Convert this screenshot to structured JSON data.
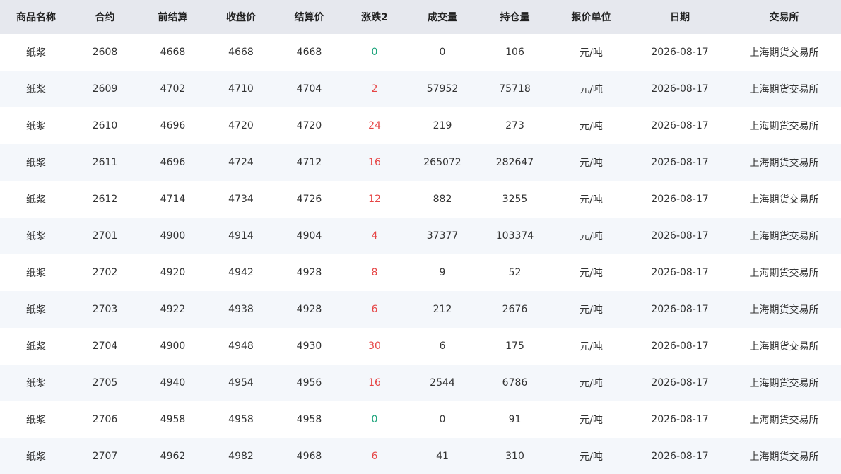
{
  "table": {
    "headers": [
      "商品名称",
      "合约",
      "前结算",
      "收盘价",
      "结算价",
      "涨跌2",
      "成交量",
      "持仓量",
      "报价单位",
      "日期",
      "交易所"
    ],
    "rows": [
      {
        "name": "纸浆",
        "contract": "2608",
        "prev_settle": "4668",
        "close": "4668",
        "settle": "4668",
        "change": "0",
        "volume": "0",
        "open_interest": "106",
        "unit": "元/吨",
        "date": "2026-08-17",
        "exchange": "上海期货交易所"
      },
      {
        "name": "纸浆",
        "contract": "2609",
        "prev_settle": "4702",
        "close": "4710",
        "settle": "4704",
        "change": "2",
        "volume": "57952",
        "open_interest": "75718",
        "unit": "元/吨",
        "date": "2026-08-17",
        "exchange": "上海期货交易所"
      },
      {
        "name": "纸浆",
        "contract": "2610",
        "prev_settle": "4696",
        "close": "4720",
        "settle": "4720",
        "change": "24",
        "volume": "219",
        "open_interest": "273",
        "unit": "元/吨",
        "date": "2026-08-17",
        "exchange": "上海期货交易所"
      },
      {
        "name": "纸浆",
        "contract": "2611",
        "prev_settle": "4696",
        "close": "4724",
        "settle": "4712",
        "change": "16",
        "volume": "265072",
        "open_interest": "282647",
        "unit": "元/吨",
        "date": "2026-08-17",
        "exchange": "上海期货交易所"
      },
      {
        "name": "纸浆",
        "contract": "2612",
        "prev_settle": "4714",
        "close": "4734",
        "settle": "4726",
        "change": "12",
        "volume": "882",
        "open_interest": "3255",
        "unit": "元/吨",
        "date": "2026-08-17",
        "exchange": "上海期货交易所"
      },
      {
        "name": "纸浆",
        "contract": "2701",
        "prev_settle": "4900",
        "close": "4914",
        "settle": "4904",
        "change": "4",
        "volume": "37377",
        "open_interest": "103374",
        "unit": "元/吨",
        "date": "2026-08-17",
        "exchange": "上海期货交易所"
      },
      {
        "name": "纸浆",
        "contract": "2702",
        "prev_settle": "4920",
        "close": "4942",
        "settle": "4928",
        "change": "8",
        "volume": "9",
        "open_interest": "52",
        "unit": "元/吨",
        "date": "2026-08-17",
        "exchange": "上海期货交易所"
      },
      {
        "name": "纸浆",
        "contract": "2703",
        "prev_settle": "4922",
        "close": "4938",
        "settle": "4928",
        "change": "6",
        "volume": "212",
        "open_interest": "2676",
        "unit": "元/吨",
        "date": "2026-08-17",
        "exchange": "上海期货交易所"
      },
      {
        "name": "纸浆",
        "contract": "2704",
        "prev_settle": "4900",
        "close": "4948",
        "settle": "4930",
        "change": "30",
        "volume": "6",
        "open_interest": "175",
        "unit": "元/吨",
        "date": "2026-08-17",
        "exchange": "上海期货交易所"
      },
      {
        "name": "纸浆",
        "contract": "2705",
        "prev_settle": "4940",
        "close": "4954",
        "settle": "4956",
        "change": "16",
        "volume": "2544",
        "open_interest": "6786",
        "unit": "元/吨",
        "date": "2026-08-17",
        "exchange": "上海期货交易所"
      },
      {
        "name": "纸浆",
        "contract": "2706",
        "prev_settle": "4958",
        "close": "4958",
        "settle": "4958",
        "change": "0",
        "volume": "0",
        "open_interest": "91",
        "unit": "元/吨",
        "date": "2026-08-17",
        "exchange": "上海期货交易所"
      },
      {
        "name": "纸浆",
        "contract": "2707",
        "prev_settle": "4962",
        "close": "4982",
        "settle": "4968",
        "change": "6",
        "volume": "41",
        "open_interest": "310",
        "unit": "元/吨",
        "date": "2026-08-17",
        "exchange": "上海期货交易所"
      }
    ]
  },
  "colors": {
    "header_bg": "#e6e8ee",
    "row_alt_bg": "#f4f7fb",
    "up": "#e64545",
    "flat": "#1aa37a"
  }
}
